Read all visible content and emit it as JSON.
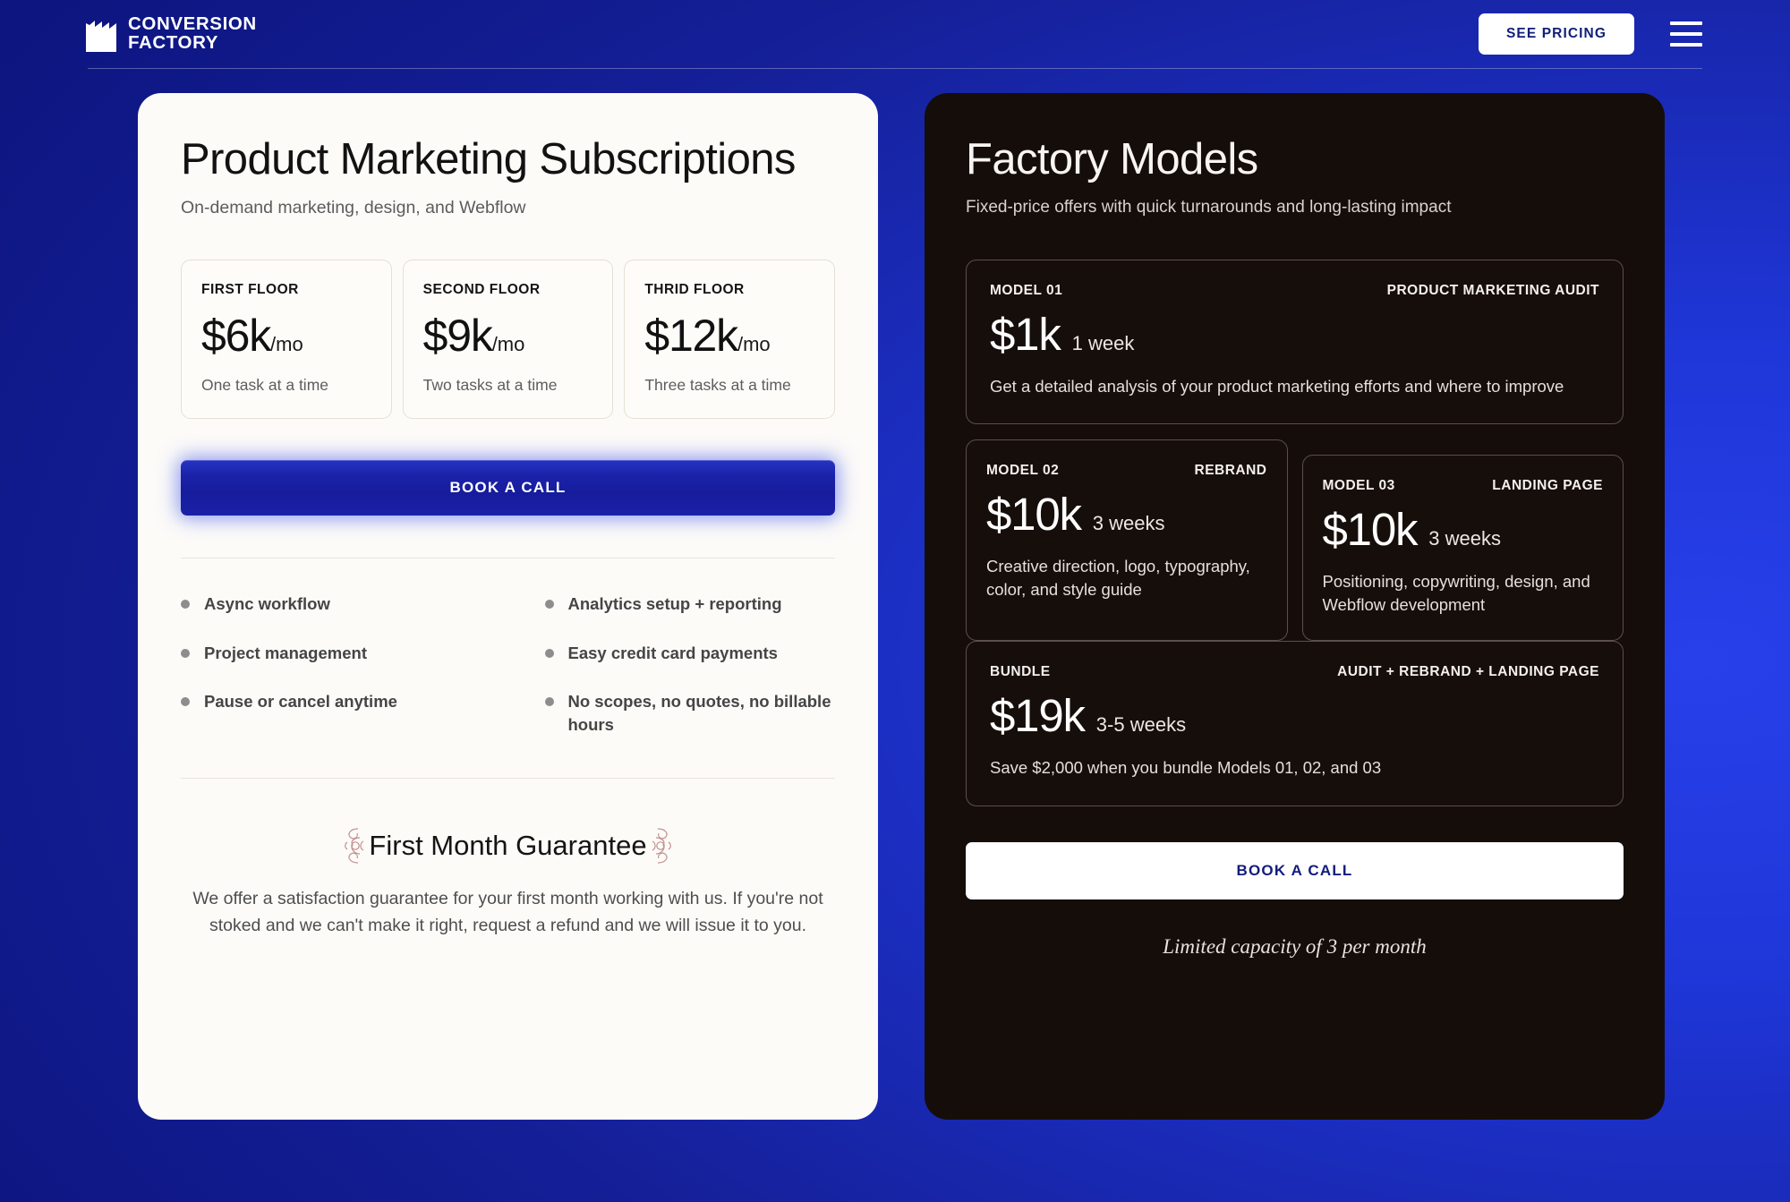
{
  "header": {
    "logo_name": "CONVERSION",
    "logo_name_2": "FACTORY",
    "cta_label": "SEE PRICING",
    "menu_icon": "hamburger-menu-icon",
    "logo_icon": "factory-icon"
  },
  "left_panel": {
    "title": "Product Marketing Subscriptions",
    "subtitle": "On-demand marketing, design, and Webflow",
    "tiers": [
      {
        "name": "FIRST FLOOR",
        "price": "$6k",
        "period": "/mo",
        "desc": "One task at a time"
      },
      {
        "name": "SECOND FLOOR",
        "price": "$9k",
        "period": "/mo",
        "desc": "Two tasks at a time"
      },
      {
        "name": "THRID FLOOR",
        "price": "$12k",
        "period": "/mo",
        "desc": "Three tasks at a time"
      }
    ],
    "cta_label": "BOOK A CALL",
    "features_left": [
      "Async workflow",
      "Project management",
      "Pause or cancel anytime"
    ],
    "features_right": [
      "Analytics setup + reporting",
      "Easy credit card payments",
      "No scopes, no quotes, no billable hours"
    ],
    "guarantee_title": "First Month Guarantee",
    "guarantee_body": "We offer a satisfaction guarantee for your first month working with us. If you're not stoked and we can't make it right, request a refund and we will issue it to you.",
    "ornament_icon": "decorative-flourish-icon"
  },
  "right_panel": {
    "title": "Factory Models",
    "subtitle": "Fixed-price offers with quick turnarounds and long-lasting impact",
    "models": [
      {
        "id": "MODEL 01",
        "tag": "PRODUCT MARKETING AUDIT",
        "price": "$1k",
        "duration": "1 week",
        "desc": "Get a detailed analysis of your product marketing efforts and where to improve"
      },
      {
        "id": "MODEL 02",
        "tag": "REBRAND",
        "price": "$10k",
        "duration": "3 weeks",
        "desc": "Creative direction, logo, typography, color, and style guide"
      },
      {
        "id": "MODEL 03",
        "tag": "LANDING PAGE",
        "price": "$10k",
        "duration": "3 weeks",
        "desc": "Positioning, copywriting, design, and Webflow development"
      },
      {
        "id": "BUNDLE",
        "tag": "AUDIT + REBRAND + LANDING PAGE",
        "price": "$19k",
        "duration": "3-5 weeks",
        "desc": "Save $2,000 when you bundle Models 01, 02, and 03"
      }
    ],
    "cta_label": "BOOK A CALL",
    "capacity_note": "Limited capacity of 3 per month"
  },
  "colors": {
    "background_navy": "#0d1580",
    "background_blue": "#1f36d8",
    "card_light": "#fcfbf8",
    "card_dark": "#150d0a",
    "cta_blue": "#1b22a8",
    "cta_blue_text": "#121c7e",
    "ornament_pink": "#c2908f",
    "model_border": "#5b4f49"
  }
}
